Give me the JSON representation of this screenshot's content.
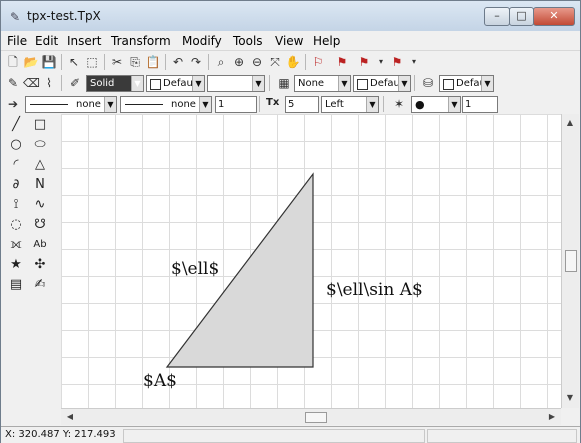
{
  "window": {
    "title": "tpx-test.TpX",
    "minimize": "–",
    "maximize": "□",
    "close": "✕"
  },
  "menu": [
    "File",
    "Edit",
    "Insert",
    "Transform",
    "Modify",
    "Tools",
    "View",
    "Help"
  ],
  "toolbar2": {
    "line_style": "Solid",
    "line_color": "Defau",
    "line_width": "",
    "hatch": "None",
    "fill_color": "Defau",
    "bg_color": "Defau"
  },
  "toolbar3": {
    "arrow_start": "none",
    "arrow_end": "none",
    "arrow_size": "1",
    "text_label": "Tx",
    "text_size": "5",
    "text_align": "Left",
    "mark_size": "1"
  },
  "toolbox": {
    "text_tool": "Ab"
  },
  "drawing": {
    "labels": {
      "hypotenuse": "$\\ell$",
      "right_side": "$\\ell\\sin A$",
      "vertex": "$A$"
    },
    "triangle_fill": "#d9d9d9",
    "grid_color": "#dcdcdc"
  },
  "status": {
    "coords": "X: 320.487 Y: 217.493"
  }
}
